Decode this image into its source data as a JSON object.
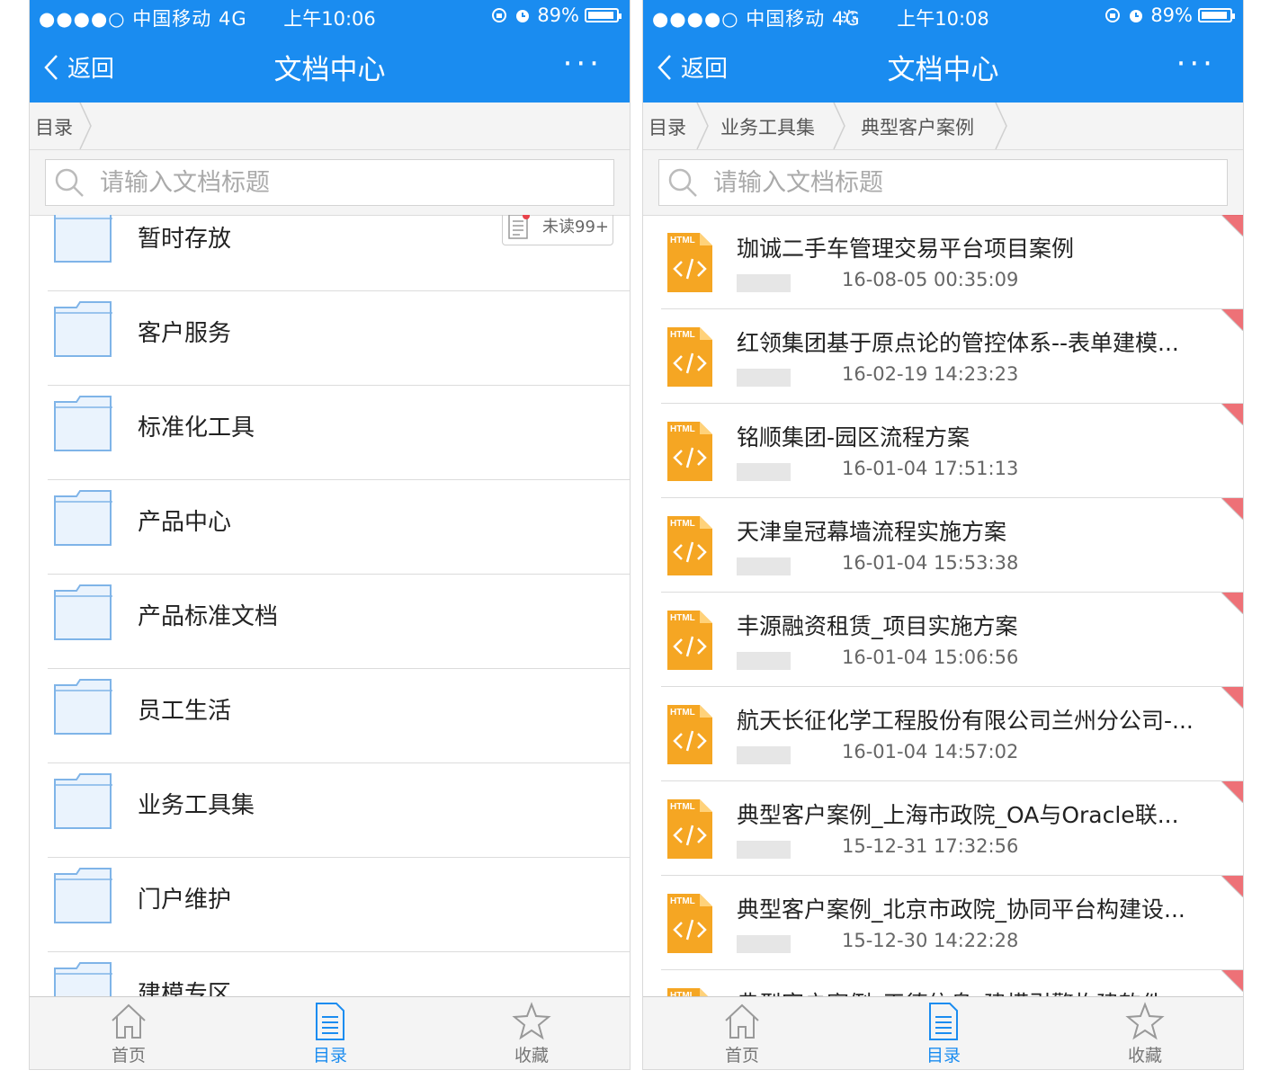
{
  "colors": {
    "brand_blue": "#1a8cf0",
    "html_icon_orange": "#f5a623",
    "unread_red": "#e8424a"
  },
  "left": {
    "status": {
      "signal": "●●●●○ 中国移动 4G",
      "time": "上午10:06",
      "battery": "89%"
    },
    "nav": {
      "back": "返回",
      "title": "文档中心",
      "more": "···"
    },
    "breadcrumb": [
      "目录"
    ],
    "search_placeholder": "请输入文档标题",
    "unread_badge": "未读99+",
    "folders": [
      "暂时存放",
      "客户服务",
      "标准化工具",
      "产品中心",
      "产品标准文档",
      "员工生活",
      "业务工具集",
      "门户维护",
      "建模专区"
    ],
    "tabs": [
      "首页",
      "目录",
      "收藏"
    ],
    "active_tab": "目录"
  },
  "right": {
    "status": {
      "signal": "●●●●○ 中国移动 4G",
      "time": "上午10:08",
      "battery": "89%"
    },
    "nav": {
      "back": "返回",
      "title": "文档中心",
      "more": "···"
    },
    "breadcrumb": [
      "目录",
      "业务工具集",
      "典型客户案例"
    ],
    "search_placeholder": "请输入文档标题",
    "doc_icon_label": "HTML",
    "docs": [
      {
        "title": "珈诚二手车管理交易平台项目案例",
        "date": "16-08-05 00:35:09"
      },
      {
        "title": "红领集团基于原点论的管控体系--表单建模...",
        "date": "16-02-19 14:23:23"
      },
      {
        "title": "铭顺集团-园区流程方案",
        "date": "16-01-04 17:51:13"
      },
      {
        "title": "天津皇冠幕墙流程实施方案",
        "date": "16-01-04 15:53:38"
      },
      {
        "title": "丰源融资租赁_项目实施方案",
        "date": "16-01-04 15:06:56"
      },
      {
        "title": "航天长征化学工程股份有限公司兰州分公司-...",
        "date": "16-01-04 14:57:02"
      },
      {
        "title": "典型客户案例_上海市政院_OA与Oracle联...",
        "date": "15-12-31 17:32:56"
      },
      {
        "title": "典型客户案例_北京市政院_协同平台构建设...",
        "date": "15-12-30 14:22:28"
      },
      {
        "title": "典型客户案例_天德信息_建模引擎构建软件...",
        "date": ""
      }
    ],
    "tabs": [
      "首页",
      "目录",
      "收藏"
    ],
    "active_tab": "目录"
  }
}
